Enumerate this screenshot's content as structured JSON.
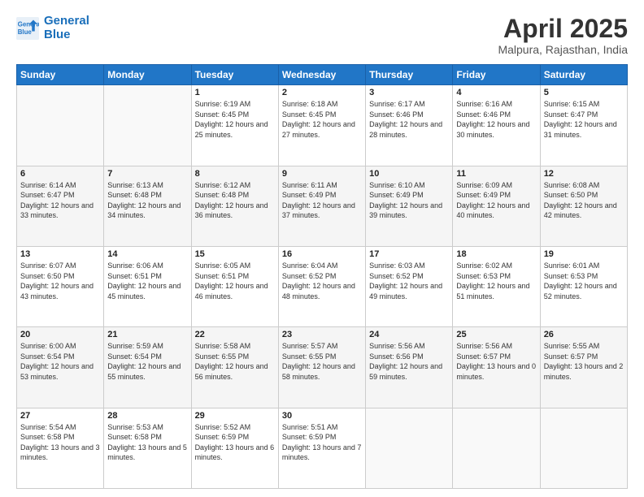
{
  "header": {
    "logo_line1": "General",
    "logo_line2": "Blue",
    "title": "April 2025",
    "subtitle": "Malpura, Rajasthan, India"
  },
  "weekdays": [
    "Sunday",
    "Monday",
    "Tuesday",
    "Wednesday",
    "Thursday",
    "Friday",
    "Saturday"
  ],
  "weeks": [
    [
      {
        "day": "",
        "text": ""
      },
      {
        "day": "",
        "text": ""
      },
      {
        "day": "1",
        "text": "Sunrise: 6:19 AM\nSunset: 6:45 PM\nDaylight: 12 hours and 25 minutes."
      },
      {
        "day": "2",
        "text": "Sunrise: 6:18 AM\nSunset: 6:45 PM\nDaylight: 12 hours and 27 minutes."
      },
      {
        "day": "3",
        "text": "Sunrise: 6:17 AM\nSunset: 6:46 PM\nDaylight: 12 hours and 28 minutes."
      },
      {
        "day": "4",
        "text": "Sunrise: 6:16 AM\nSunset: 6:46 PM\nDaylight: 12 hours and 30 minutes."
      },
      {
        "day": "5",
        "text": "Sunrise: 6:15 AM\nSunset: 6:47 PM\nDaylight: 12 hours and 31 minutes."
      }
    ],
    [
      {
        "day": "6",
        "text": "Sunrise: 6:14 AM\nSunset: 6:47 PM\nDaylight: 12 hours and 33 minutes."
      },
      {
        "day": "7",
        "text": "Sunrise: 6:13 AM\nSunset: 6:48 PM\nDaylight: 12 hours and 34 minutes."
      },
      {
        "day": "8",
        "text": "Sunrise: 6:12 AM\nSunset: 6:48 PM\nDaylight: 12 hours and 36 minutes."
      },
      {
        "day": "9",
        "text": "Sunrise: 6:11 AM\nSunset: 6:49 PM\nDaylight: 12 hours and 37 minutes."
      },
      {
        "day": "10",
        "text": "Sunrise: 6:10 AM\nSunset: 6:49 PM\nDaylight: 12 hours and 39 minutes."
      },
      {
        "day": "11",
        "text": "Sunrise: 6:09 AM\nSunset: 6:49 PM\nDaylight: 12 hours and 40 minutes."
      },
      {
        "day": "12",
        "text": "Sunrise: 6:08 AM\nSunset: 6:50 PM\nDaylight: 12 hours and 42 minutes."
      }
    ],
    [
      {
        "day": "13",
        "text": "Sunrise: 6:07 AM\nSunset: 6:50 PM\nDaylight: 12 hours and 43 minutes."
      },
      {
        "day": "14",
        "text": "Sunrise: 6:06 AM\nSunset: 6:51 PM\nDaylight: 12 hours and 45 minutes."
      },
      {
        "day": "15",
        "text": "Sunrise: 6:05 AM\nSunset: 6:51 PM\nDaylight: 12 hours and 46 minutes."
      },
      {
        "day": "16",
        "text": "Sunrise: 6:04 AM\nSunset: 6:52 PM\nDaylight: 12 hours and 48 minutes."
      },
      {
        "day": "17",
        "text": "Sunrise: 6:03 AM\nSunset: 6:52 PM\nDaylight: 12 hours and 49 minutes."
      },
      {
        "day": "18",
        "text": "Sunrise: 6:02 AM\nSunset: 6:53 PM\nDaylight: 12 hours and 51 minutes."
      },
      {
        "day": "19",
        "text": "Sunrise: 6:01 AM\nSunset: 6:53 PM\nDaylight: 12 hours and 52 minutes."
      }
    ],
    [
      {
        "day": "20",
        "text": "Sunrise: 6:00 AM\nSunset: 6:54 PM\nDaylight: 12 hours and 53 minutes."
      },
      {
        "day": "21",
        "text": "Sunrise: 5:59 AM\nSunset: 6:54 PM\nDaylight: 12 hours and 55 minutes."
      },
      {
        "day": "22",
        "text": "Sunrise: 5:58 AM\nSunset: 6:55 PM\nDaylight: 12 hours and 56 minutes."
      },
      {
        "day": "23",
        "text": "Sunrise: 5:57 AM\nSunset: 6:55 PM\nDaylight: 12 hours and 58 minutes."
      },
      {
        "day": "24",
        "text": "Sunrise: 5:56 AM\nSunset: 6:56 PM\nDaylight: 12 hours and 59 minutes."
      },
      {
        "day": "25",
        "text": "Sunrise: 5:56 AM\nSunset: 6:57 PM\nDaylight: 13 hours and 0 minutes."
      },
      {
        "day": "26",
        "text": "Sunrise: 5:55 AM\nSunset: 6:57 PM\nDaylight: 13 hours and 2 minutes."
      }
    ],
    [
      {
        "day": "27",
        "text": "Sunrise: 5:54 AM\nSunset: 6:58 PM\nDaylight: 13 hours and 3 minutes."
      },
      {
        "day": "28",
        "text": "Sunrise: 5:53 AM\nSunset: 6:58 PM\nDaylight: 13 hours and 5 minutes."
      },
      {
        "day": "29",
        "text": "Sunrise: 5:52 AM\nSunset: 6:59 PM\nDaylight: 13 hours and 6 minutes."
      },
      {
        "day": "30",
        "text": "Sunrise: 5:51 AM\nSunset: 6:59 PM\nDaylight: 13 hours and 7 minutes."
      },
      {
        "day": "",
        "text": ""
      },
      {
        "day": "",
        "text": ""
      },
      {
        "day": "",
        "text": ""
      }
    ]
  ]
}
